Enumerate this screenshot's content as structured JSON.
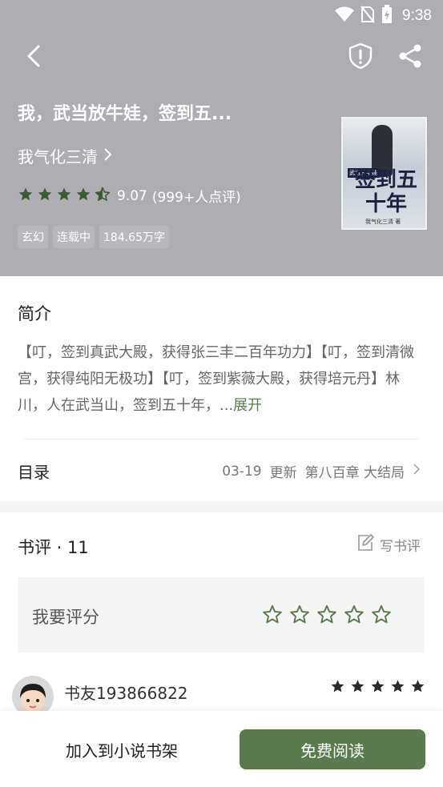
{
  "status_bar": {
    "time": "9:38",
    "icons": [
      "wifi-icon",
      "no-sim-icon",
      "battery-charging-icon"
    ]
  },
  "header": {
    "back_icon": "back-arrow-icon",
    "report_icon": "shield-alert-icon",
    "share_icon": "share-icon"
  },
  "book": {
    "title": "我，武当放牛娃，签到五...",
    "author": "我气化三清",
    "rating_score": "9.07",
    "rating_count": "(999+人点评)",
    "rating_stars": 4.5,
    "tags": [
      "玄幻",
      "连载中",
      "184.65万字"
    ],
    "cover": {
      "main_text": "签到五十年",
      "side_text": "武当放牛娃",
      "author_text": "我气化三清 著"
    }
  },
  "intro": {
    "title": "简介",
    "text": "【叮，签到真武大殿，获得张三丰二百年功力】【叮，签到清微宫，获得纯阳无极功】【叮，签到紫薇大殿，获得培元丹】林川，人在武当山，签到五十年，...",
    "expand_label": "展开"
  },
  "toc": {
    "label": "目录",
    "update_date": "03-19",
    "update_word": "更新",
    "latest_chapter": "第八百章 大结局"
  },
  "reviews": {
    "title": "书评 · 11",
    "write_label": "写书评",
    "rate_prompt": "我要评分",
    "rate_star_count": 5,
    "items": [
      {
        "name": "书友193866822",
        "stars": 5
      }
    ]
  },
  "bottom_bar": {
    "add_shelf_label": "加入到小说书架",
    "read_label": "免费阅读"
  },
  "colors": {
    "accent": "#5b7a4d",
    "hero_bg": "#adadb2",
    "star_filled_header": "#3c5a32",
    "star_dark": "#2a2a2a"
  }
}
